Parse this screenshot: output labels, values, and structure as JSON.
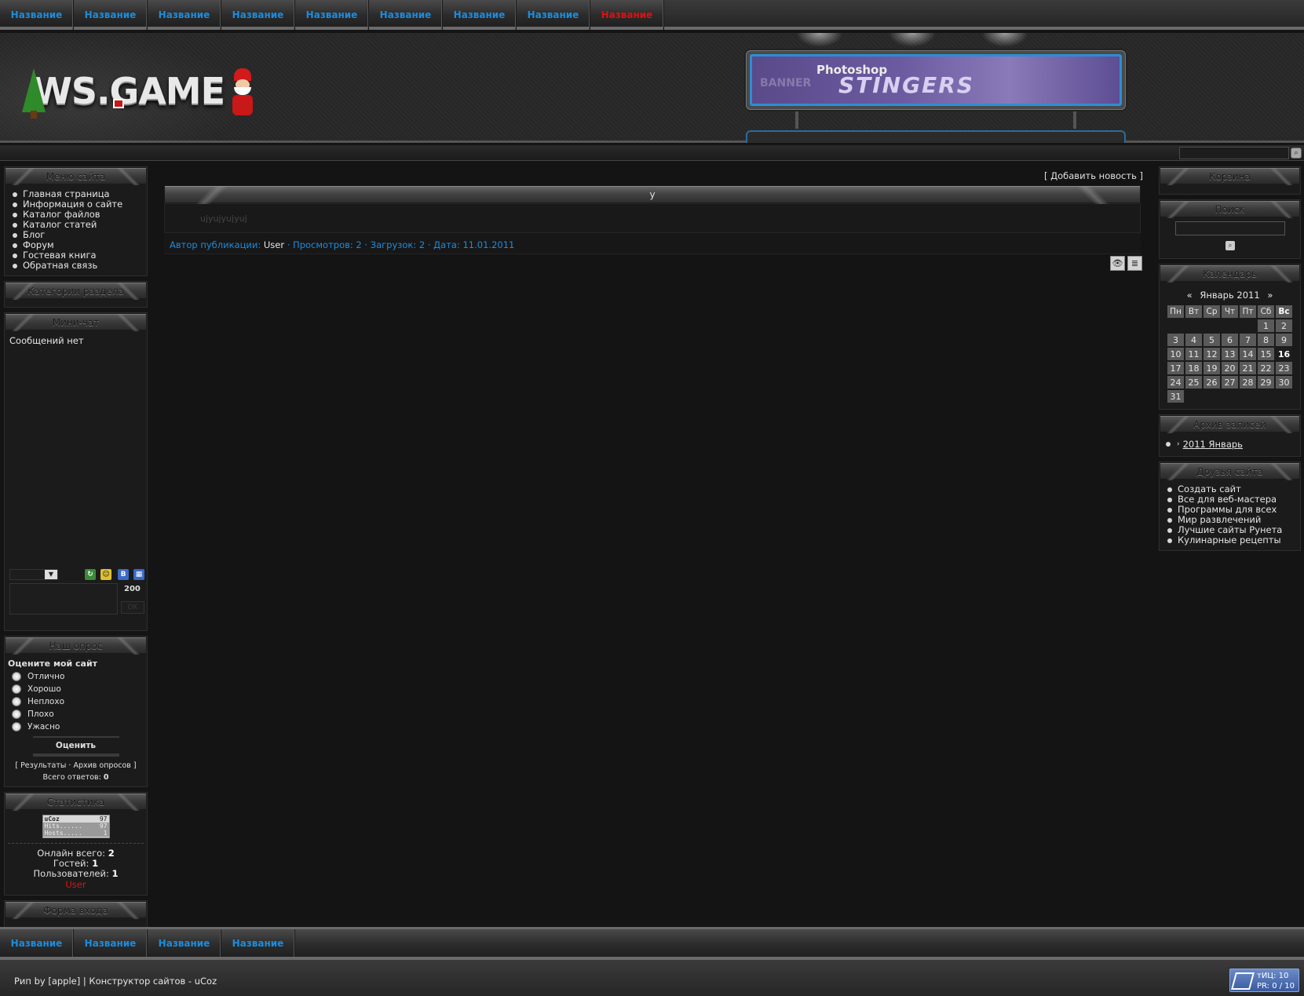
{
  "top_nav": [
    "Название",
    "Название",
    "Название",
    "Название",
    "Название",
    "Название",
    "Название",
    "Название",
    "Название"
  ],
  "top_nav_active_index": 8,
  "logo": {
    "text": "WS.GAME"
  },
  "banner": {
    "line1": "Photoshop",
    "line2": "STINGERS",
    "ghost": "BANNER"
  },
  "left": {
    "menu_title": "Меню сайта",
    "menu_items": [
      "Главная страница",
      "Информация о сайте",
      "Каталог файлов",
      "Каталог статей",
      "Блог",
      "Форум",
      "Гостевая книга",
      "Обратная связь"
    ],
    "categories_title": "Категории раздела",
    "minichat_title": "Мини-чат",
    "minichat_empty": "Сообщений нет",
    "minichat_counter": "200",
    "minichat_ok": "OK",
    "poll_title": "Наш опрос",
    "poll_question": "Оцените мой сайт",
    "poll_options": [
      "Отлично",
      "Хорошо",
      "Неплохо",
      "Плохо",
      "Ужасно"
    ],
    "poll_button": "Оценить",
    "poll_results": "Результаты",
    "poll_archive": "Архив опросов",
    "poll_total_label": "Всего ответов:",
    "poll_total_value": "0",
    "stats_title": "Статистика",
    "counter": {
      "brand": "uCoz",
      "brand_value": "97",
      "hits_label": "Hits......",
      "hits_value": "97",
      "hosts_label": "Hosts.....",
      "hosts_value": "1"
    },
    "online_total_label": "Онлайн всего:",
    "online_total": "2",
    "guests_label": "Гостей:",
    "guests": "1",
    "users_label": "Пользователей:",
    "users": "1",
    "online_user": "User",
    "login_title": "Форма входа"
  },
  "center": {
    "add_news": "[ Добавить новость ]",
    "post_title": "у",
    "post_body": "ujyujyujyuj",
    "meta_author_label": "Автор публикации:",
    "meta_author": "User",
    "meta_views": "· Просмотров: 2 · Загрузок: 2 · Дата: 11.01.2011"
  },
  "right": {
    "cart_title": "Корзина",
    "search_title": "Поиск",
    "calendar_title": "Календарь",
    "calendar_month": "Январь 2011",
    "calendar_prev": "«",
    "calendar_next": "»",
    "weekdays": [
      "Пн",
      "Вт",
      "Ср",
      "Чт",
      "Пт",
      "Сб",
      "Вс"
    ],
    "weeks": [
      [
        "",
        "",
        "",
        "",
        "",
        "1",
        "2"
      ],
      [
        "3",
        "4",
        "5",
        "6",
        "7",
        "8",
        "9"
      ],
      [
        "10",
        "11",
        "12",
        "13",
        "14",
        "15",
        "16"
      ],
      [
        "17",
        "18",
        "19",
        "20",
        "21",
        "22",
        "23"
      ],
      [
        "24",
        "25",
        "26",
        "27",
        "28",
        "29",
        "30"
      ],
      [
        "31",
        "",
        "",
        "",
        "",
        "",
        ""
      ]
    ],
    "today": "16",
    "archive_title": "Архив записей",
    "archive_item": "2011 Январь",
    "friends_title": "Друзья сайта",
    "friends": [
      "Создать сайт",
      "Все для веб-мастера",
      "Программы для всех",
      "Мир развлечений",
      "Лучшие сайты Рунета",
      "Кулинарные рецепты"
    ]
  },
  "bottom_nav": [
    "Название",
    "Название",
    "Название",
    "Название"
  ],
  "footer": {
    "copyright": "Рип by [apple] | Конструктор сайтов - uCoz",
    "tic_line1": "тИЦ: 10",
    "tic_line2": "PR: 0 / 10"
  },
  "colors": {
    "link_blue": "#1e8cdc",
    "active_red": "#e01010",
    "background": "#141414"
  }
}
